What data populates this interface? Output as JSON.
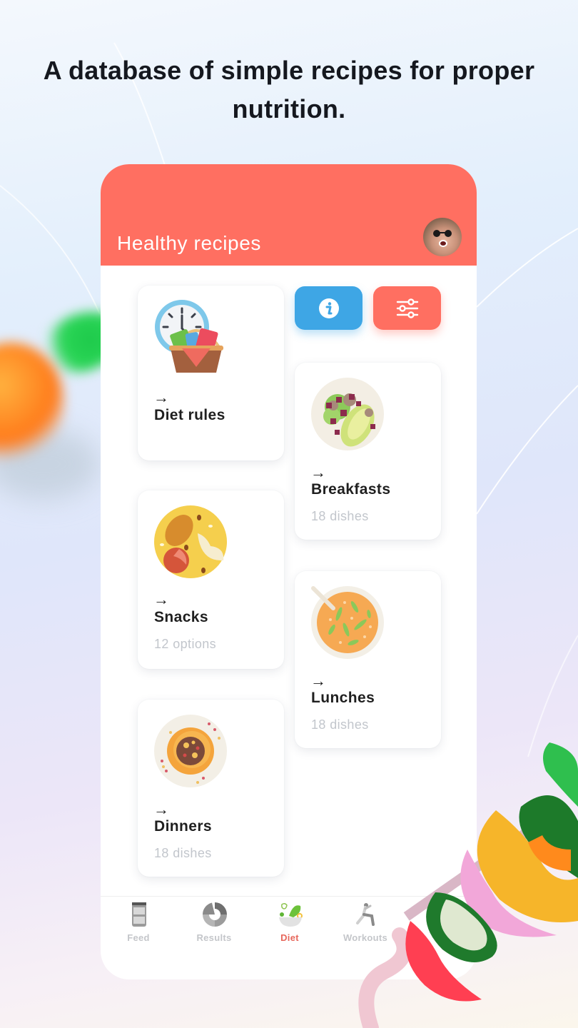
{
  "headline": "A database of simple recipes for proper nutrition.",
  "colors": {
    "accent": "#ff6f61",
    "info_button": "#3ea6e5",
    "active_tab": "#e7675c",
    "inactive_tab": "#c4c6ca",
    "subtitle_gray": "#c2c6cc"
  },
  "app": {
    "title": "Healthy recipes",
    "avatar": "user-avatar-photo",
    "actions": [
      {
        "name": "info",
        "icon": "info-icon"
      },
      {
        "name": "filters",
        "icon": "sliders-icon"
      }
    ],
    "cards": [
      {
        "arrow": "→",
        "title": "Diet rules",
        "subtitle": "",
        "icon": "clock-basket-icon"
      },
      {
        "arrow": "→",
        "title": "Breakfasts",
        "subtitle": "18 dishes",
        "icon": "salad-bowl-icon"
      },
      {
        "arrow": "→",
        "title": "Snacks",
        "subtitle": "12 options",
        "icon": "nuts-plate-icon"
      },
      {
        "arrow": "→",
        "title": "Lunches",
        "subtitle": "18 dishes",
        "icon": "soup-bowl-icon"
      },
      {
        "arrow": "→",
        "title": "Dinners",
        "subtitle": "18 dishes",
        "icon": "dinner-plate-icon"
      }
    ],
    "tabs": [
      {
        "label": "Feed",
        "icon": "feed-icon",
        "active": false
      },
      {
        "label": "Results",
        "icon": "results-chart-icon",
        "active": false
      },
      {
        "label": "Diet",
        "icon": "diet-salad-icon",
        "active": true
      },
      {
        "label": "Workouts",
        "icon": "workout-icon",
        "active": false
      }
    ]
  }
}
